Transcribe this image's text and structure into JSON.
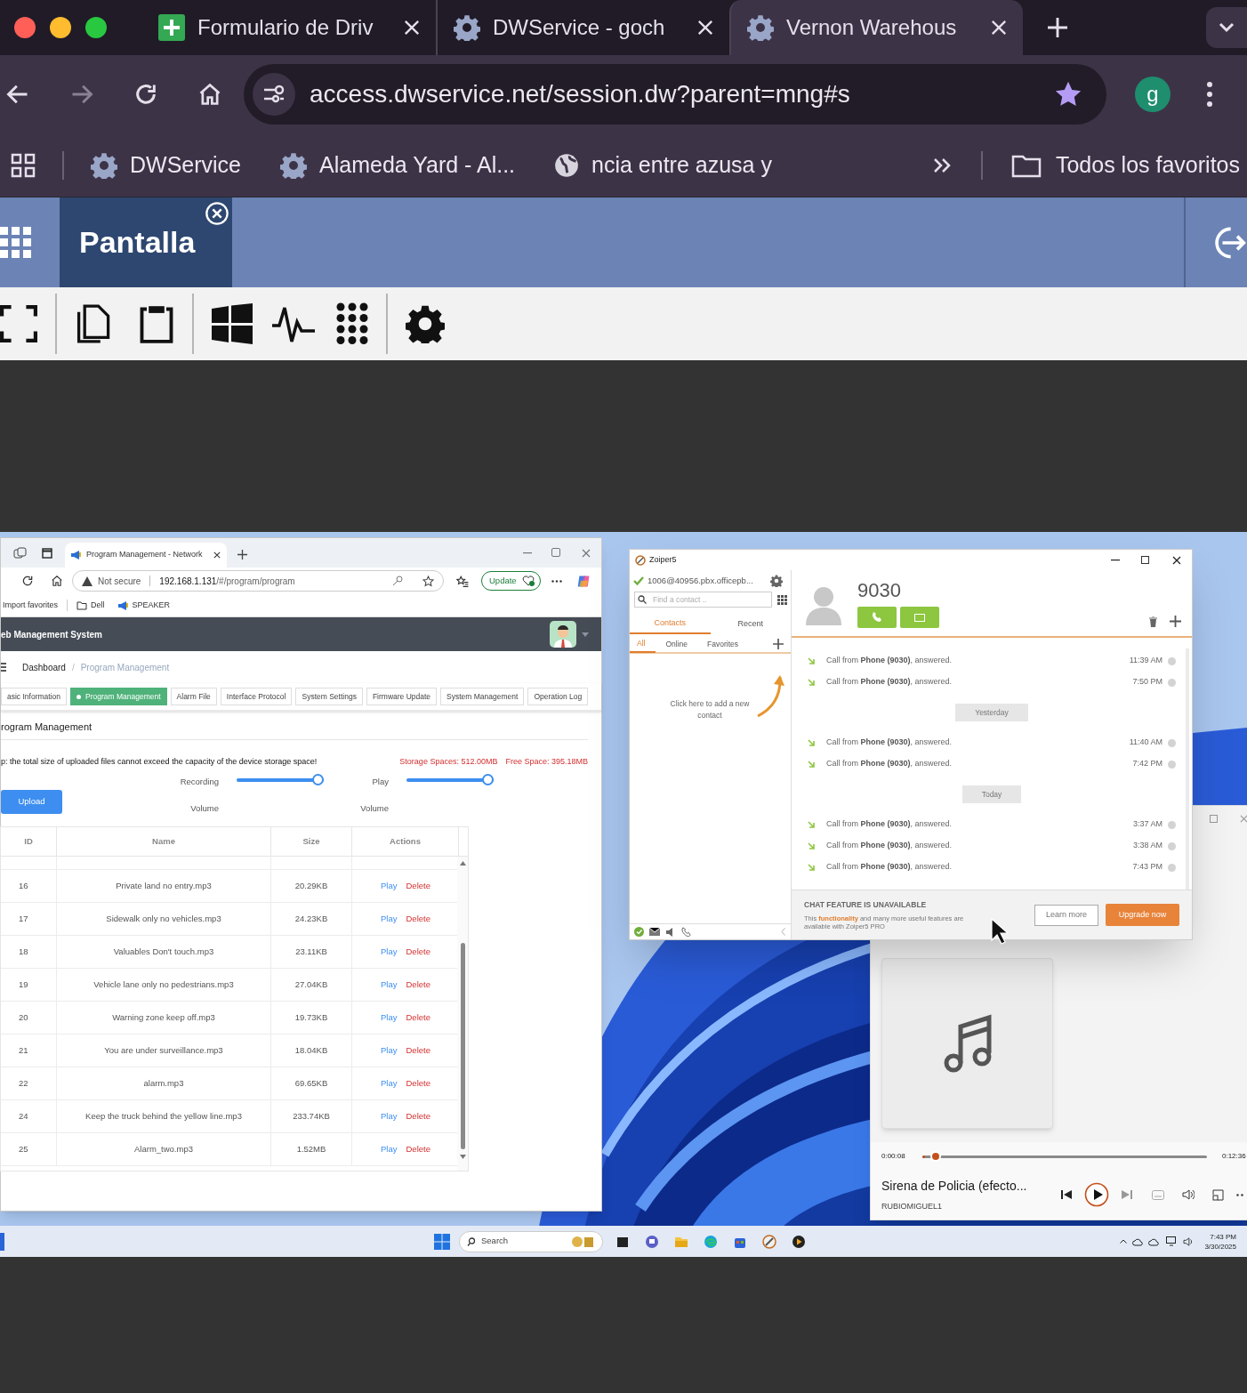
{
  "browser": {
    "tabs": [
      {
        "title": "Formulario de Driv",
        "selected": false
      },
      {
        "title": "DWService - goch",
        "selected": false
      },
      {
        "title": "Vernon Warehous",
        "selected": true
      }
    ],
    "url": "access.dwservice.net/session.dw?parent=mng#s",
    "profile_initial": "g",
    "bookmarks": [
      "DWService",
      "Alameda Yard - Al...",
      "ncia entre azusa y"
    ],
    "all_bookmarks": "Todos los favoritos"
  },
  "session": {
    "tab": "Pantalla"
  },
  "edge": {
    "tab_title": "Program Management - Network",
    "security": "Not secure",
    "url_host": "192.168.1.131",
    "url_path": "/#/program/program",
    "update_button": "Update",
    "favorites": [
      "Import favorites",
      "Dell",
      "SPEAKER"
    ],
    "app_title": "eb Management System",
    "breadcrumb": [
      "Dashboard",
      "Program Management"
    ],
    "breadcrumb_separator": "/",
    "nav_tabs": [
      {
        "label": "asic Information",
        "selected": false
      },
      {
        "label": "Program Management",
        "selected": true
      },
      {
        "label": "Alarm File",
        "selected": false
      },
      {
        "label": "Interface Protocol",
        "selected": false
      },
      {
        "label": "System Settings",
        "selected": false
      },
      {
        "label": "Firmware Update",
        "selected": false
      },
      {
        "label": "System Management",
        "selected": false
      },
      {
        "label": "Operation Log",
        "selected": false
      }
    ],
    "section_title": "rogram Management",
    "tip": "p: the total size of uploaded files cannot exceed the capacity of the device storage space!",
    "storage": "Storage Spaces: 512.00MB",
    "free_space": "Free Space: 395.18MB",
    "upload": "Upload",
    "sliders": [
      {
        "label": "Recording",
        "sublabel": "Volume",
        "level": 1
      },
      {
        "label": "Play",
        "sublabel": "Volume",
        "level": 1
      }
    ],
    "table": {
      "columns": [
        "ID",
        "Name",
        "Size",
        "Actions"
      ],
      "rows": [
        {
          "id": "16",
          "name": "Private land no entry.mp3",
          "size": "20.29KB",
          "actions": [
            "Play",
            "Delete"
          ]
        },
        {
          "id": "17",
          "name": "Sidewalk only no vehicles.mp3",
          "size": "24.23KB",
          "actions": [
            "Play",
            "Delete"
          ]
        },
        {
          "id": "18",
          "name": "Valuables Don't touch.mp3",
          "size": "23.11KB",
          "actions": [
            "Play",
            "Delete"
          ]
        },
        {
          "id": "19",
          "name": "Vehicle lane only no pedestrians.mp3",
          "size": "27.04KB",
          "actions": [
            "Play",
            "Delete"
          ]
        },
        {
          "id": "20",
          "name": "Warning zone keep off.mp3",
          "size": "19.73KB",
          "actions": [
            "Play",
            "Delete"
          ]
        },
        {
          "id": "21",
          "name": "You are under surveillance.mp3",
          "size": "18.04KB",
          "actions": [
            "Play",
            "Delete"
          ]
        },
        {
          "id": "22",
          "name": "alarm.mp3",
          "size": "69.65KB",
          "actions": [
            "Play",
            "Delete"
          ]
        },
        {
          "id": "24",
          "name": "Keep the truck behind the yellow line.mp3",
          "size": "233.74KB",
          "actions": [
            "Play",
            "Delete"
          ]
        },
        {
          "id": "25",
          "name": "Alarm_two.mp3",
          "size": "1.52MB",
          "actions": [
            "Play",
            "Delete"
          ]
        }
      ]
    }
  },
  "zoiper": {
    "title": "Zoiper5",
    "account": "1006@40956.pbx.officepb...",
    "search_placeholder": "Find a contact ..",
    "tabs": [
      {
        "label": "Contacts",
        "selected": true
      },
      {
        "label": "Recent",
        "selected": false
      }
    ],
    "filters": [
      {
        "label": "All",
        "selected": true
      },
      {
        "label": "Online",
        "selected": false
      },
      {
        "label": "Favorites",
        "selected": false
      }
    ],
    "hint": "Click here to add a new contact",
    "contact": "9030",
    "history": [
      {
        "kind": "call",
        "text": "Call from **Phone (9030)**, answered.",
        "time": "11:39 AM"
      },
      {
        "kind": "call",
        "text": "Call from **Phone (9030)**, answered.",
        "time": "7:50 PM"
      },
      {
        "kind": "date",
        "text": "Yesterday"
      },
      {
        "kind": "call",
        "text": "Call from **Phone (9030)**, answered.",
        "time": "11:40 AM"
      },
      {
        "kind": "call",
        "text": "Call from **Phone (9030)**, answered.",
        "time": "7:42 PM"
      },
      {
        "kind": "date",
        "text": "Today"
      },
      {
        "kind": "call",
        "text": "Call from **Phone (9030)**, answered.",
        "time": "3:37 AM"
      },
      {
        "kind": "call",
        "text": "Call from **Phone (9030)**, answered.",
        "time": "3:38 AM"
      },
      {
        "kind": "call",
        "text": "Call from **Phone (9030)**, answered.",
        "time": "7:43 PM"
      }
    ],
    "banner_title": "CHAT FEATURE IS UNAVAILABLE",
    "banner_text": "This **functionality** and many more useful features are available with Zoiper5 PRO",
    "learn_more": "Learn more",
    "upgrade": "Upgrade now"
  },
  "player": {
    "elapsed": "0:00:08",
    "total": "0:12:36",
    "level": 0.01,
    "title": "Sirena de Policia (efecto...",
    "artist": "RUBIOMIGUEL1"
  },
  "taskbar": {
    "search": "Search",
    "time": "7:43 PM",
    "date": "3/30/2025"
  }
}
